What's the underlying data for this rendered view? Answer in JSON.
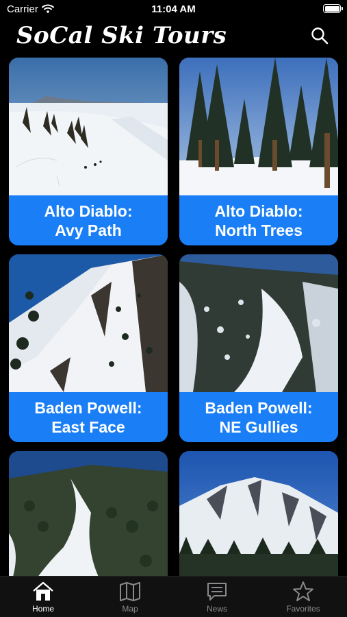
{
  "status": {
    "carrier": "Carrier",
    "time": "11:04 AM"
  },
  "header": {
    "title": "SoCal Ski Tours"
  },
  "tours": [
    {
      "line1": "Alto Diablo:",
      "line2": "Avy Path"
    },
    {
      "line1": "Alto Diablo:",
      "line2": "North Trees"
    },
    {
      "line1": "Baden Powell:",
      "line2": "East Face"
    },
    {
      "line1": "Baden Powell:",
      "line2": "NE Gullies"
    },
    {
      "line1": "",
      "line2": ""
    },
    {
      "line1": "",
      "line2": ""
    }
  ],
  "tabs": [
    {
      "label": "Home",
      "icon": "home-icon",
      "active": true
    },
    {
      "label": "Map",
      "icon": "map-icon"
    },
    {
      "label": "News",
      "icon": "news-icon"
    },
    {
      "label": "Favorites",
      "icon": "star-icon"
    }
  ],
  "colors": {
    "background": "#000000",
    "card_label": "#1a7ff6",
    "tab_active": "#ffffff",
    "tab_inactive": "#8a8a8e"
  }
}
